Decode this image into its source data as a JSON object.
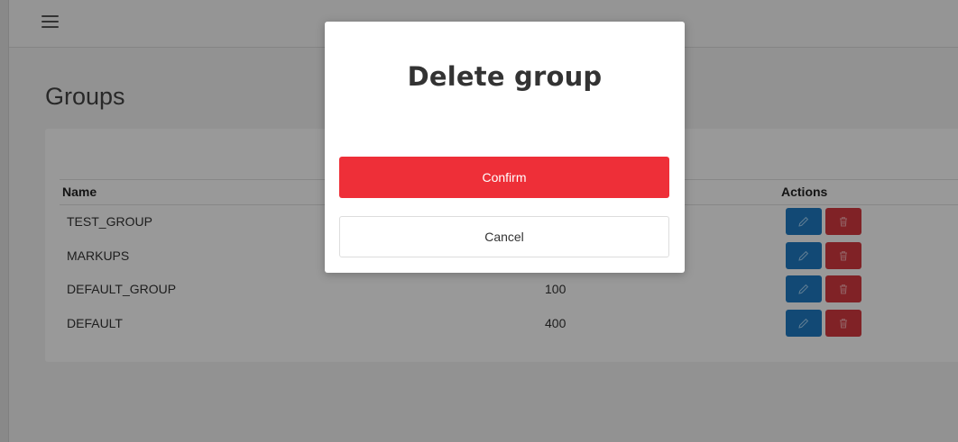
{
  "header": {
    "menu_icon": "hamburger-icon"
  },
  "page": {
    "title": "Groups"
  },
  "table": {
    "columns": {
      "name": "Name",
      "actions": "Actions"
    },
    "rows": [
      {
        "name": "TEST_GROUP",
        "value": ""
      },
      {
        "name": "MARKUPS",
        "value": ""
      },
      {
        "name": "DEFAULT_GROUP",
        "value": "100"
      },
      {
        "name": "DEFAULT",
        "value": "400"
      }
    ],
    "edit_icon": "pencil-icon",
    "delete_icon": "trash-icon"
  },
  "modal": {
    "title": "Delete group",
    "confirm_label": "Confirm",
    "cancel_label": "Cancel"
  },
  "colors": {
    "edit_button": "#1f7ac4",
    "delete_button": "#d63a40",
    "confirm_button": "#ee2f38"
  }
}
